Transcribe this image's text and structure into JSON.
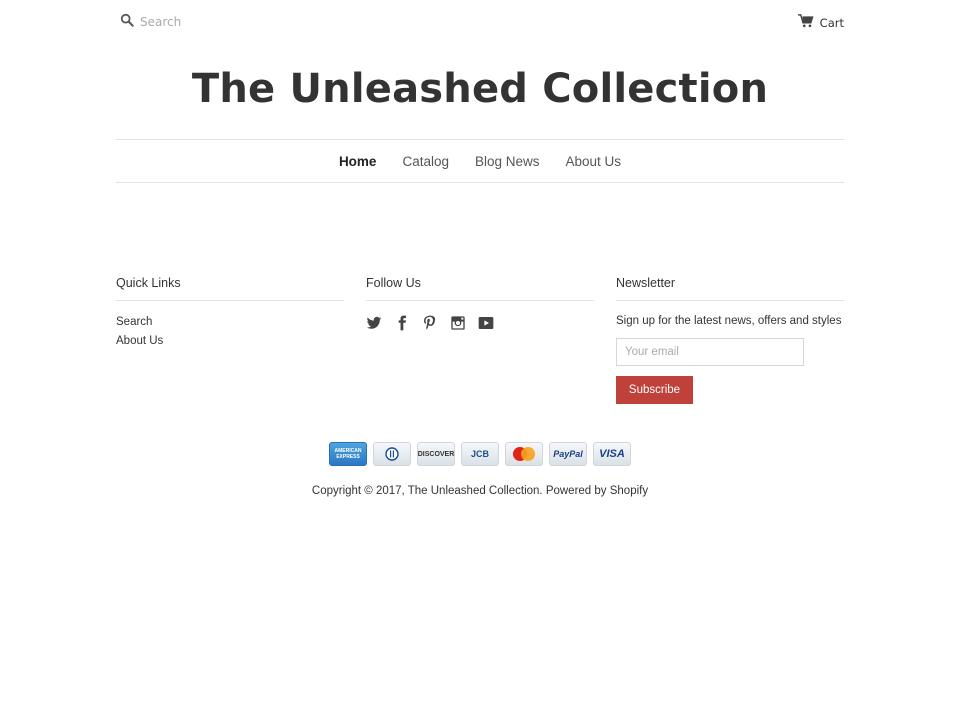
{
  "header": {
    "search_placeholder": "Search",
    "search_icon": "search-icon",
    "cart_label": "Cart",
    "cart_icon": "cart-icon"
  },
  "site_title": "The Unleashed Collection",
  "nav": {
    "items": [
      {
        "label": "Home",
        "active": true
      },
      {
        "label": "Catalog"
      },
      {
        "label": "Blog News"
      },
      {
        "label": "About Us"
      }
    ]
  },
  "footer": {
    "quick_links": {
      "heading": "Quick Links",
      "items": [
        "Search",
        "About Us"
      ]
    },
    "follow_us": {
      "heading": "Follow Us",
      "icons": [
        "twitter-icon",
        "facebook-icon",
        "pinterest-icon",
        "instagram-icon",
        "youtube-icon"
      ]
    },
    "newsletter": {
      "heading": "Newsletter",
      "text": "Sign up for the latest news, offers and styles",
      "email_placeholder": "Your email",
      "button_label": "Subscribe",
      "button_color": "#c0413a"
    }
  },
  "payments": {
    "amex": "AMERICAN EXPRESS",
    "diners": "",
    "discover": "DISCOVER",
    "jcb": "JCB",
    "mastercard": "MasterCard",
    "paypal": "PayPal",
    "visa": "VISA"
  },
  "copyright": "Copyright © 2017, The Unleashed Collection. Powered by Shopify"
}
